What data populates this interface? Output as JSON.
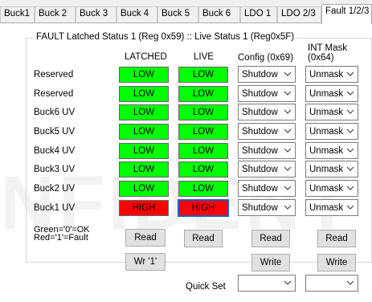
{
  "tabs": [
    "Buck1",
    "Buck 2",
    "Buck 3",
    "Buck 4",
    "Buck 5",
    "Buck 6",
    "LDO 1",
    "LDO 2/3",
    "Fault 1/2/3"
  ],
  "active_tab": "Fault 1/2/3",
  "group": {
    "title": "FAULT Latched Status 1 (Reg 0x59) :: Live Status 1 (Reg0x5F)"
  },
  "columns": {
    "latched": "LATCHED",
    "live": "LIVE",
    "config": "Config (0x69)",
    "int_mask_line1": "INT Mask",
    "int_mask_line2": "(0x64)"
  },
  "rows": [
    {
      "label": "Reserved",
      "latched": "LOW",
      "live": "LOW",
      "config": "Shutdow",
      "mask": "Unmask"
    },
    {
      "label": "Reserved",
      "latched": "LOW",
      "live": "LOW",
      "config": "Shutdow",
      "mask": "Unmask"
    },
    {
      "label": "Buck6 UV",
      "latched": "LOW",
      "live": "LOW",
      "config": "Shutdow",
      "mask": "Unmask"
    },
    {
      "label": "Buck5 UV",
      "latched": "LOW",
      "live": "LOW",
      "config": "Shutdow",
      "mask": "Unmask"
    },
    {
      "label": "Buck4 UV",
      "latched": "LOW",
      "live": "LOW",
      "config": "Shutdow",
      "mask": "Unmask"
    },
    {
      "label": "Buck3 UV",
      "latched": "LOW",
      "live": "LOW",
      "config": "Shutdow",
      "mask": "Unmask"
    },
    {
      "label": "Buck2 UV",
      "latched": "LOW",
      "live": "LOW",
      "config": "Shutdow",
      "mask": "Unmask"
    },
    {
      "label": "Buck1 UV",
      "latched": "HIGH",
      "live": "HIGH",
      "config": "Shutdow",
      "mask": "Unmask"
    }
  ],
  "legend_note": {
    "line1": "Green='0'=OK",
    "line2": "Red='1'=Fault"
  },
  "buttons": {
    "read_latched": "Read",
    "read_live": "Read",
    "read_config": "Read",
    "read_mask": "Read",
    "wr1": "Wr '1'",
    "write_config": "Write",
    "write_mask": "Write"
  },
  "quick_set": {
    "label": "Quick Set",
    "config_value": "",
    "mask_value": ""
  },
  "colors": {
    "low": "#00ff00",
    "high": "#ff0000",
    "focus": "#1a5fc4"
  },
  "watermark": "NFIDENT"
}
